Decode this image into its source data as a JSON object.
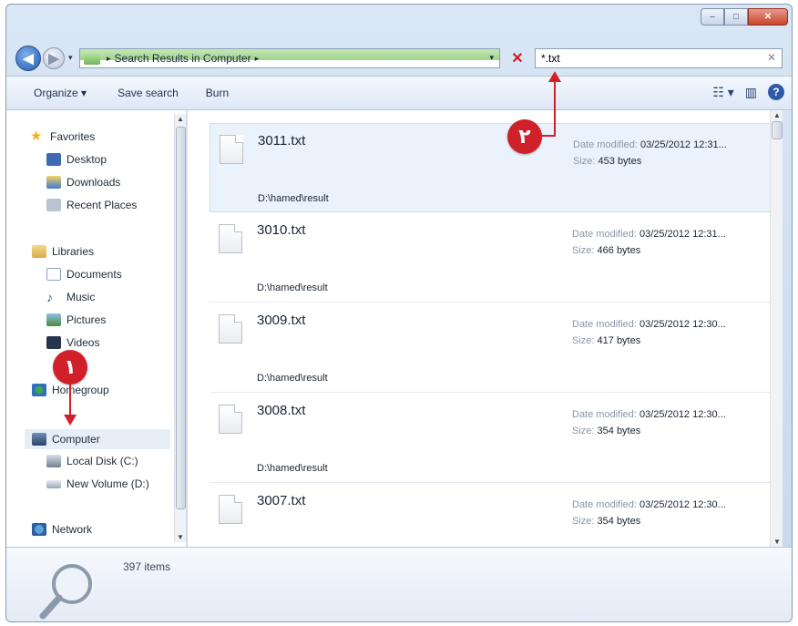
{
  "window": {
    "caption_min": "–",
    "caption_max": "□",
    "caption_close": "✕"
  },
  "address": {
    "nav_back_glyph": "◀",
    "nav_fwd_glyph": "▶",
    "breadcrumb_sep": "▸",
    "breadcrumb": "Search Results in Computer",
    "breadcrumb_sep2": "▸",
    "dropdown_glyph": "▾",
    "clear_glyph": "✕"
  },
  "search": {
    "value": "*.txt",
    "clear_glyph": "✕"
  },
  "toolbar": {
    "organize": "Organize ▾",
    "save_search": "Save search",
    "burn": "Burn",
    "views_glyph": "☷ ▾",
    "preview_glyph": "▥",
    "help_glyph": "?"
  },
  "nav": {
    "favorites": "Favorites",
    "desktop": "Desktop",
    "downloads": "Downloads",
    "recent_places": "Recent Places",
    "libraries": "Libraries",
    "documents": "Documents",
    "music": "Music",
    "pictures": "Pictures",
    "videos": "Videos",
    "homegroup": "Homegroup",
    "computer": "Computer",
    "local_disk": "Local Disk (C:)",
    "new_volume": "New Volume (D:)",
    "network": "Network"
  },
  "results": [
    {
      "name": "3011.txt",
      "path": "D:\\hamed\\result",
      "date_label": "Date modified:",
      "date": "03/25/2012 12:31...",
      "size_label": "Size:",
      "size": "453 bytes"
    },
    {
      "name": "3010.txt",
      "path": "D:\\hamed\\result",
      "date_label": "Date modified:",
      "date": "03/25/2012 12:31...",
      "size_label": "Size:",
      "size": "466 bytes"
    },
    {
      "name": "3009.txt",
      "path": "D:\\hamed\\result",
      "date_label": "Date modified:",
      "date": "03/25/2012 12:30...",
      "size_label": "Size:",
      "size": "417 bytes"
    },
    {
      "name": "3008.txt",
      "path": "D:\\hamed\\result",
      "date_label": "Date modified:",
      "date": "03/25/2012 12:30...",
      "size_label": "Size:",
      "size": "354 bytes"
    },
    {
      "name": "3007.txt",
      "path": "",
      "date_label": "Date modified:",
      "date": "03/25/2012 12:30...",
      "size_label": "Size:",
      "size": "354 bytes"
    }
  ],
  "details": {
    "item_count": "397 items"
  },
  "annotations": {
    "badge1": "١",
    "badge2": "٢"
  },
  "colors": {
    "accent_red": "#d0202a",
    "address_green": "#9fd38b",
    "selection_blue": "#eaf2fb"
  }
}
